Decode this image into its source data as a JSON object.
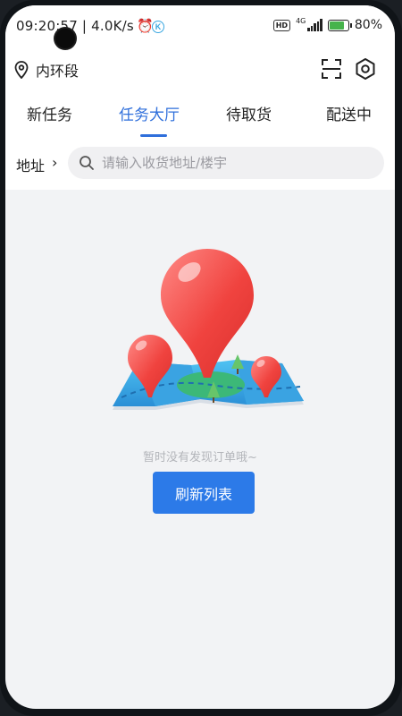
{
  "status_bar": {
    "time_speed": "09:20:57 | 4.0K/s",
    "alarm_icon": "alarm-icon",
    "network": "4G",
    "hd_badge": "HD",
    "battery": "80%"
  },
  "header": {
    "location": "内环段",
    "location_icon": "location-pin-icon",
    "scan_icon": "scan-icon",
    "settings_icon": "settings-icon"
  },
  "tabs": [
    {
      "label": "新任务",
      "active": false
    },
    {
      "label": "任务大厅",
      "active": true
    },
    {
      "label": "待取货",
      "active": false
    },
    {
      "label": "配送中",
      "active": false
    }
  ],
  "search": {
    "address_label": "地址",
    "placeholder": "请输入收货地址/楼宇"
  },
  "empty_state": {
    "message": "暂时没有发现订单哦~",
    "refresh_label": "刷新列表"
  },
  "colors": {
    "accent": "#2f6fdb",
    "button": "#2c7ae8",
    "background": "#f2f3f5"
  }
}
